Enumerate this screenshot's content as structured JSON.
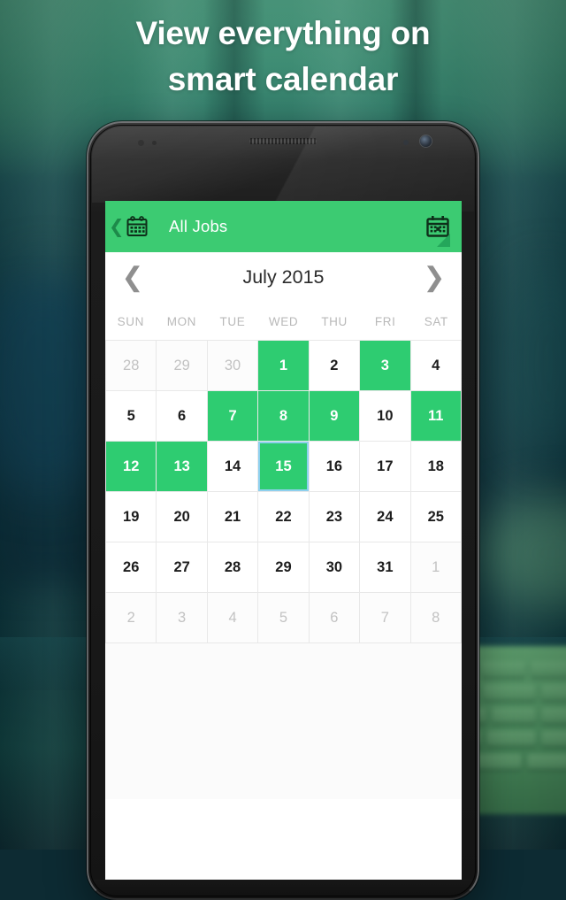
{
  "headline": {
    "line1": "View everything on",
    "line2": "smart calendar"
  },
  "colors": {
    "accent_green": "#2ecc71",
    "appbar_green": "#3ccb72",
    "appbar_triangle": "#24a75b",
    "selection_blue": "#8ed0ee",
    "muted_text": "#c2c2c2",
    "headline_text": "#ffffff",
    "background_teal": "#0e3540"
  },
  "appbar": {
    "back_icon": "chevron-left-icon",
    "left_icon": "calendar-icon",
    "title": "All Jobs",
    "right_icon": "calendar-today-icon",
    "corner_indicator": "triangle-resize-handle"
  },
  "month_header": {
    "prev_icon": "chevron-left-icon",
    "title": "July 2015",
    "next_icon": "chevron-right-icon"
  },
  "weekdays": [
    "SUN",
    "MON",
    "TUE",
    "WED",
    "THU",
    "FRI",
    "SAT"
  ],
  "calendar": {
    "month": "July",
    "year": "2015",
    "selected_day": "15",
    "weeks": [
      [
        {
          "label": "28",
          "state": "muted"
        },
        {
          "label": "29",
          "state": "muted"
        },
        {
          "label": "30",
          "state": "muted"
        },
        {
          "label": "1",
          "state": "event"
        },
        {
          "label": "2",
          "state": "normal"
        },
        {
          "label": "3",
          "state": "event"
        },
        {
          "label": "4",
          "state": "normal"
        }
      ],
      [
        {
          "label": "5",
          "state": "normal"
        },
        {
          "label": "6",
          "state": "normal"
        },
        {
          "label": "7",
          "state": "event"
        },
        {
          "label": "8",
          "state": "event"
        },
        {
          "label": "9",
          "state": "event"
        },
        {
          "label": "10",
          "state": "normal"
        },
        {
          "label": "11",
          "state": "event"
        }
      ],
      [
        {
          "label": "12",
          "state": "event"
        },
        {
          "label": "13",
          "state": "event"
        },
        {
          "label": "14",
          "state": "normal"
        },
        {
          "label": "15",
          "state": "event",
          "selected": true
        },
        {
          "label": "16",
          "state": "normal"
        },
        {
          "label": "17",
          "state": "normal"
        },
        {
          "label": "18",
          "state": "normal"
        }
      ],
      [
        {
          "label": "19",
          "state": "normal"
        },
        {
          "label": "20",
          "state": "normal"
        },
        {
          "label": "21",
          "state": "normal"
        },
        {
          "label": "22",
          "state": "normal"
        },
        {
          "label": "23",
          "state": "normal"
        },
        {
          "label": "24",
          "state": "normal"
        },
        {
          "label": "25",
          "state": "normal"
        }
      ],
      [
        {
          "label": "26",
          "state": "normal"
        },
        {
          "label": "27",
          "state": "normal"
        },
        {
          "label": "28",
          "state": "normal"
        },
        {
          "label": "29",
          "state": "normal"
        },
        {
          "label": "30",
          "state": "normal"
        },
        {
          "label": "31",
          "state": "normal"
        },
        {
          "label": "1",
          "state": "muted"
        }
      ],
      [
        {
          "label": "2",
          "state": "muted"
        },
        {
          "label": "3",
          "state": "muted"
        },
        {
          "label": "4",
          "state": "muted"
        },
        {
          "label": "5",
          "state": "muted"
        },
        {
          "label": "6",
          "state": "muted"
        },
        {
          "label": "7",
          "state": "muted"
        },
        {
          "label": "8",
          "state": "muted"
        }
      ]
    ]
  },
  "event_list": {
    "items": []
  }
}
